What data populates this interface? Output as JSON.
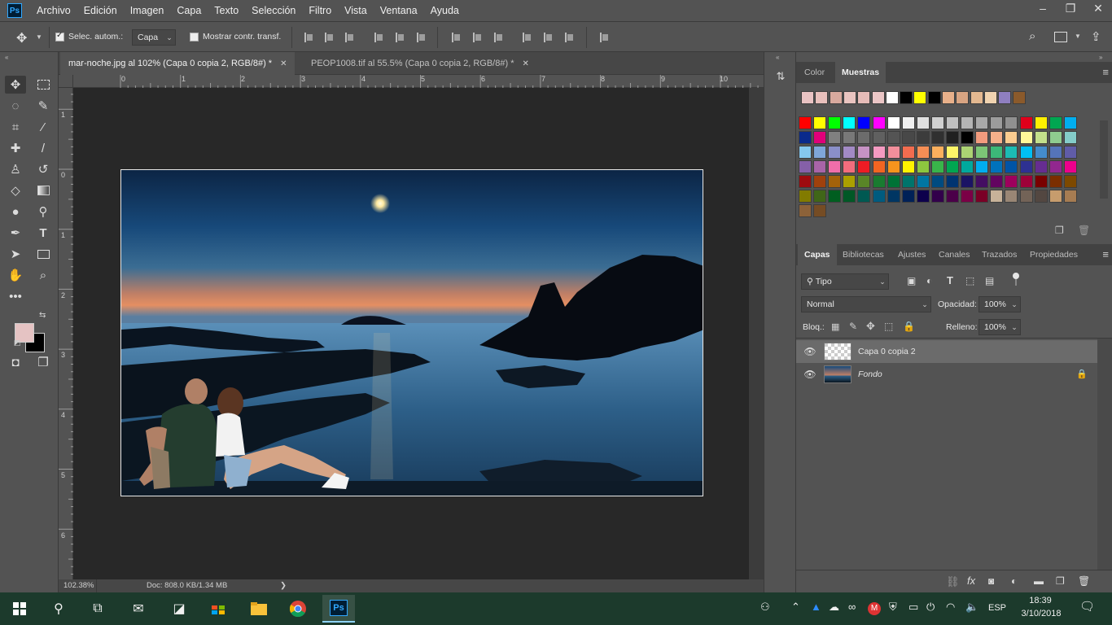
{
  "menubar": {
    "app_logo": "Ps",
    "items": [
      "Archivo",
      "Edición",
      "Imagen",
      "Capa",
      "Texto",
      "Selección",
      "Filtro",
      "Vista",
      "Ventana",
      "Ayuda"
    ],
    "window_controls": [
      "–",
      "❐",
      "✕"
    ]
  },
  "options": {
    "auto_select_label": "Selec. autom.:",
    "auto_select_checked": true,
    "auto_select_target": "Capa",
    "show_transform_label": "Mostrar contr. transf.",
    "show_transform_checked": false
  },
  "tabs": [
    {
      "label": "mar-noche.jpg al 102% (Capa 0 copia 2, RGB/8#) *",
      "active": true
    },
    {
      "label": "PEOP1008.tif al 55.5% (Capa 0 copia 2, RGB/8#) *",
      "active": false
    }
  ],
  "ruler": {
    "top": [
      "0",
      "1",
      "2",
      "3",
      "4",
      "5",
      "6",
      "7",
      "8",
      "9",
      "10"
    ],
    "left": [
      "1",
      "0",
      "1",
      "2",
      "3",
      "4",
      "5",
      "6"
    ]
  },
  "statusbar": {
    "zoom": "102.38%",
    "doc_info": "Doc: 808.0 KB/1.34 MB",
    "arrow": "❯"
  },
  "colors": {
    "foreground": "#e5c3c3",
    "background": "#000000"
  },
  "swatches_panel": {
    "tabs": [
      "Color",
      "Muestras"
    ],
    "active_tab": "Muestras",
    "recent": [
      "#e9c3c3",
      "#e8c0bc",
      "#d8a99e",
      "#e9c4c0",
      "#e6bcb8",
      "#ebc6c6",
      "#ffffff",
      "#000000",
      "#ffff00",
      "#000000",
      "#e8b08a",
      "#d8a482",
      "#e3b890",
      "#f0d3b0",
      "#8f7fc0",
      "#8b5a2b"
    ],
    "grid": [
      [
        "#ff0000",
        "#ffff00",
        "#00ff00",
        "#00ffff",
        "#0000ff",
        "#ff00ff",
        "#ffffff",
        "#f0f0f0",
        "#e0e0e0",
        "#d0d0d0",
        "#c0c0c0",
        "#b4b4b4",
        "#a8a8a8",
        "#9c9c9c",
        "#909090",
        "#e0001b",
        "#fff000",
        "#00a651",
        "#00aeef"
      ],
      [
        "#0a2a8c",
        "#e0007a",
        "#808080",
        "#787878",
        "#6c6c6c",
        "#606060",
        "#545454",
        "#484848",
        "#3c3c3c",
        "#303030",
        "#202020",
        "#000000",
        "#f29b7e",
        "#f6b08a",
        "#fbcc90",
        "#fff799",
        "#c3df8b",
        "#8fcb8f",
        "#84ccc9"
      ],
      [
        "#85c7ee",
        "#7fa6d9",
        "#8a8fc9",
        "#a28ac5",
        "#c692c4",
        "#f49ac1",
        "#f28e9b",
        "#f26c4f",
        "#f68e55",
        "#fbaf5d",
        "#fff568",
        "#acd373",
        "#7cc576",
        "#3cb878",
        "#1cbbb4",
        "#00bff3",
        "#448ccb",
        "#5574b9",
        "#605ca8"
      ],
      [
        "#8560a8",
        "#a864a8",
        "#f06eaa",
        "#f26d7d",
        "#ed1c24",
        "#f26522",
        "#f7941d",
        "#fff200",
        "#8dc63f",
        "#39b54a",
        "#00a651",
        "#00a99d",
        "#00aeef",
        "#0072bc",
        "#0054a6",
        "#2e3192",
        "#662d91",
        "#92278f",
        "#ec008c"
      ],
      [
        "#9e0b0f",
        "#a0410d",
        "#a3620a",
        "#aba000",
        "#598527",
        "#197b30",
        "#007236",
        "#00746b",
        "#0076a3",
        "#004b80",
        "#003471",
        "#1b1464",
        "#440e62",
        "#630460",
        "#9e005d",
        "#9e0039",
        "#790000",
        "#7b2e00",
        "#7d4900"
      ],
      [
        "#827b00",
        "#406618",
        "#005e20",
        "#005826",
        "#005952",
        "#005b7f",
        "#003663",
        "#002157",
        "#0d004c",
        "#32004b",
        "#4b0049",
        "#7b0046",
        "#7a0026",
        "#c7b299",
        "#998675",
        "#736357",
        "#534741",
        "#c69c6d",
        "#a67c52"
      ],
      [
        "#8c6239",
        "#754c24"
      ]
    ]
  },
  "layers_panel": {
    "tabs": [
      "Capas",
      "Bibliotecas",
      "Ajustes",
      "Canales",
      "Trazados",
      "Propiedades"
    ],
    "active_tab": "Capas",
    "filter_label": "Tipo",
    "blend_mode": "Normal",
    "opacity_label": "Opacidad:",
    "opacity_value": "100%",
    "lock_label": "Bloq.:",
    "fill_label": "Relleno:",
    "fill_value": "100%",
    "layers": [
      {
        "name": "Capa 0 copia 2",
        "visible": true,
        "selected": true,
        "locked": false
      },
      {
        "name": "Fondo",
        "visible": true,
        "selected": false,
        "locked": true
      }
    ]
  },
  "taskbar": {
    "apps": [
      "windows-start",
      "search",
      "task-view",
      "mail",
      "sticky-notes",
      "store",
      "file-explorer",
      "chrome",
      "photoshop"
    ],
    "active_app": "Ps",
    "language": "ESP",
    "time": "18:39",
    "date": "3/10/2018"
  }
}
